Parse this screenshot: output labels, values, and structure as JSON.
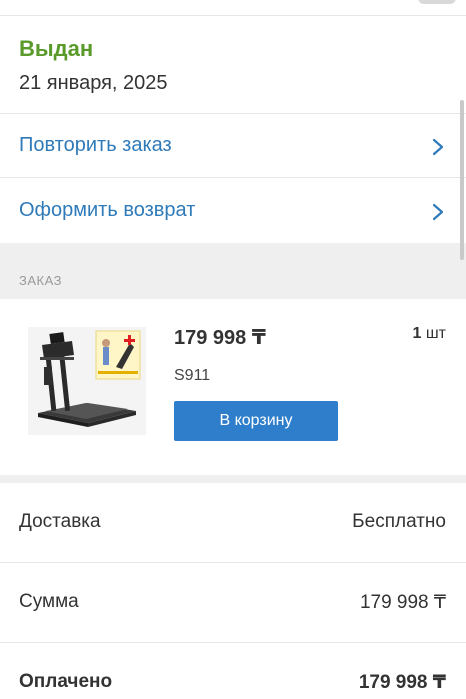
{
  "status": {
    "title": "Выдан",
    "date": "21 января, 2025",
    "color": "#5a9a2a"
  },
  "actions": [
    {
      "label": "Повторить заказ",
      "icon": "chevron-right-icon"
    },
    {
      "label": "Оформить возврат",
      "icon": "chevron-right-icon"
    }
  ],
  "order_section": {
    "title": "ЗАКАЗ",
    "item": {
      "price": "179 998 ₸",
      "quantity": "1",
      "quantity_unit": "шт",
      "sku": "S911",
      "cart_button": "В корзину",
      "image": "treadmill-product-image"
    }
  },
  "summary": [
    {
      "label": "Доставка",
      "value": "Бесплатно"
    },
    {
      "label": "Сумма",
      "value": "179 998 ₸"
    },
    {
      "label": "Оплачено",
      "value": "179 998 ₸"
    }
  ],
  "colors": {
    "link": "#2f7ab9",
    "button": "#2f7ecb",
    "section_bg": "#efefef"
  }
}
